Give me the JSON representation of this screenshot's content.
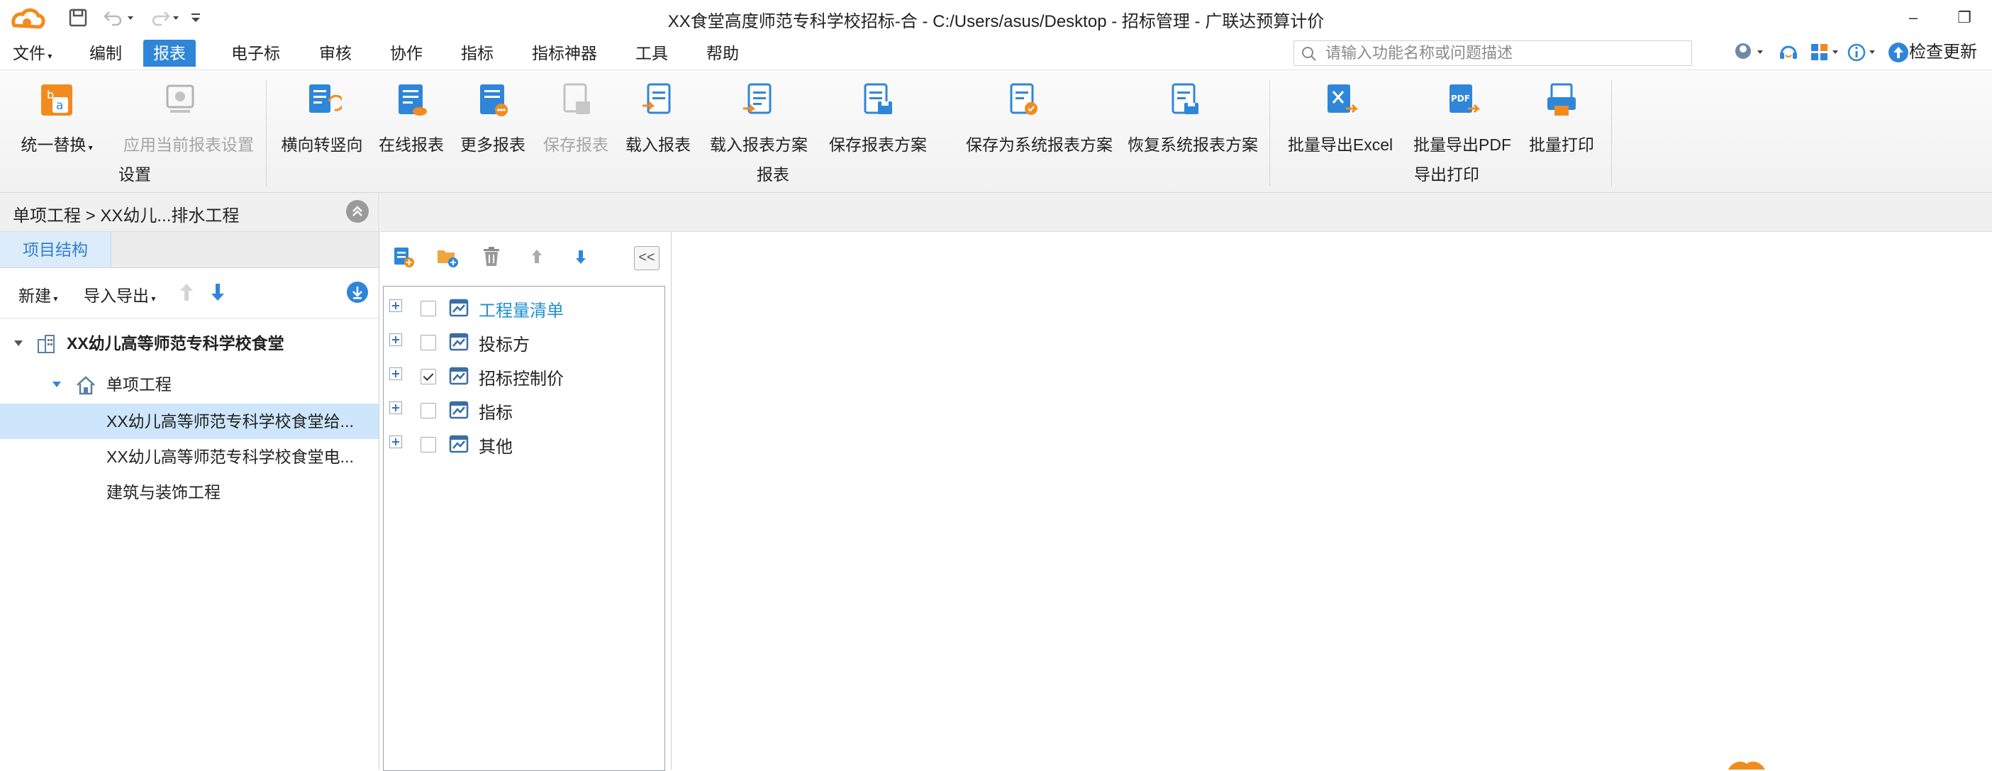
{
  "window": {
    "title": "XX食堂高度师范专科学校招标-合 - C:/Users/asus/Desktop - 招标管理 - 广联达预算计价",
    "minimize": "–",
    "restore": "❐"
  },
  "menubar": {
    "items": [
      "文件",
      "编制",
      "报表",
      "电子标",
      "审核",
      "协作",
      "指标",
      "指标神器",
      "工具",
      "帮助"
    ],
    "active": "报表",
    "search_placeholder": "请输入功能名称或问题描述",
    "update_label": "检查更新"
  },
  "ribbon": {
    "settings": {
      "group_label": "设置",
      "buttons": [
        {
          "label": "统一替换",
          "icon": "replace-icon",
          "enabled": true
        },
        {
          "label": "应用当前报表设置",
          "icon": "apply-settings-icon",
          "enabled": false
        }
      ]
    },
    "report": {
      "group_label": "报表",
      "buttons": [
        {
          "label": "横向转竖向",
          "icon": "rotate-report-icon",
          "enabled": true
        },
        {
          "label": "在线报表",
          "icon": "online-report-icon",
          "enabled": true
        },
        {
          "label": "更多报表",
          "icon": "more-report-icon",
          "enabled": true
        },
        {
          "label": "保存报表",
          "icon": "save-report-icon",
          "enabled": false
        },
        {
          "label": "载入报表",
          "icon": "load-report-icon",
          "enabled": true
        },
        {
          "label": "载入报表方案",
          "icon": "load-scheme-icon",
          "enabled": true
        },
        {
          "label": "保存报表方案",
          "icon": "save-scheme-icon",
          "enabled": true
        },
        {
          "label": "保存为系统报表方案",
          "icon": "save-system-scheme-icon",
          "enabled": true
        },
        {
          "label": "恢复系统报表方案",
          "icon": "restore-system-scheme-icon",
          "enabled": true
        }
      ]
    },
    "export": {
      "group_label": "导出打印",
      "buttons": [
        {
          "label": "批量导出Excel",
          "icon": "export-excel-icon",
          "enabled": true
        },
        {
          "label": "批量导出PDF",
          "icon": "export-pdf-icon",
          "enabled": true
        },
        {
          "label": "批量打印",
          "icon": "batch-print-icon",
          "enabled": true
        }
      ]
    }
  },
  "left_panel": {
    "breadcrumb": "单项工程 > XX幼儿...排水工程",
    "tab": "项目结构",
    "toolbar": {
      "new": "新建",
      "import_export": "导入导出"
    },
    "tree": [
      {
        "label": "XX幼儿高等师范专科学校食堂",
        "level": 0,
        "bold": true
      },
      {
        "label": "单项工程",
        "level": 1,
        "bold": false
      },
      {
        "label": "XX幼儿高等师范专科学校食堂给...",
        "level": 2,
        "selected": true
      },
      {
        "label": "XX幼儿高等师范专科学校食堂电...",
        "level": 2
      },
      {
        "label": "建筑与装饰工程",
        "level": 2
      }
    ]
  },
  "report_list": {
    "collapse": "<<",
    "items": [
      {
        "label": "工程量清单",
        "checked": false,
        "highlight": true
      },
      {
        "label": "投标方",
        "checked": false
      },
      {
        "label": "招标控制价",
        "checked": true
      },
      {
        "label": "指标",
        "checked": false
      },
      {
        "label": "其他",
        "checked": false
      }
    ]
  },
  "colors": {
    "accent": "#2f86d8",
    "selected_row": "#cde6fb",
    "link": "#1f8fd0",
    "disabled": "#a5a5a5"
  }
}
